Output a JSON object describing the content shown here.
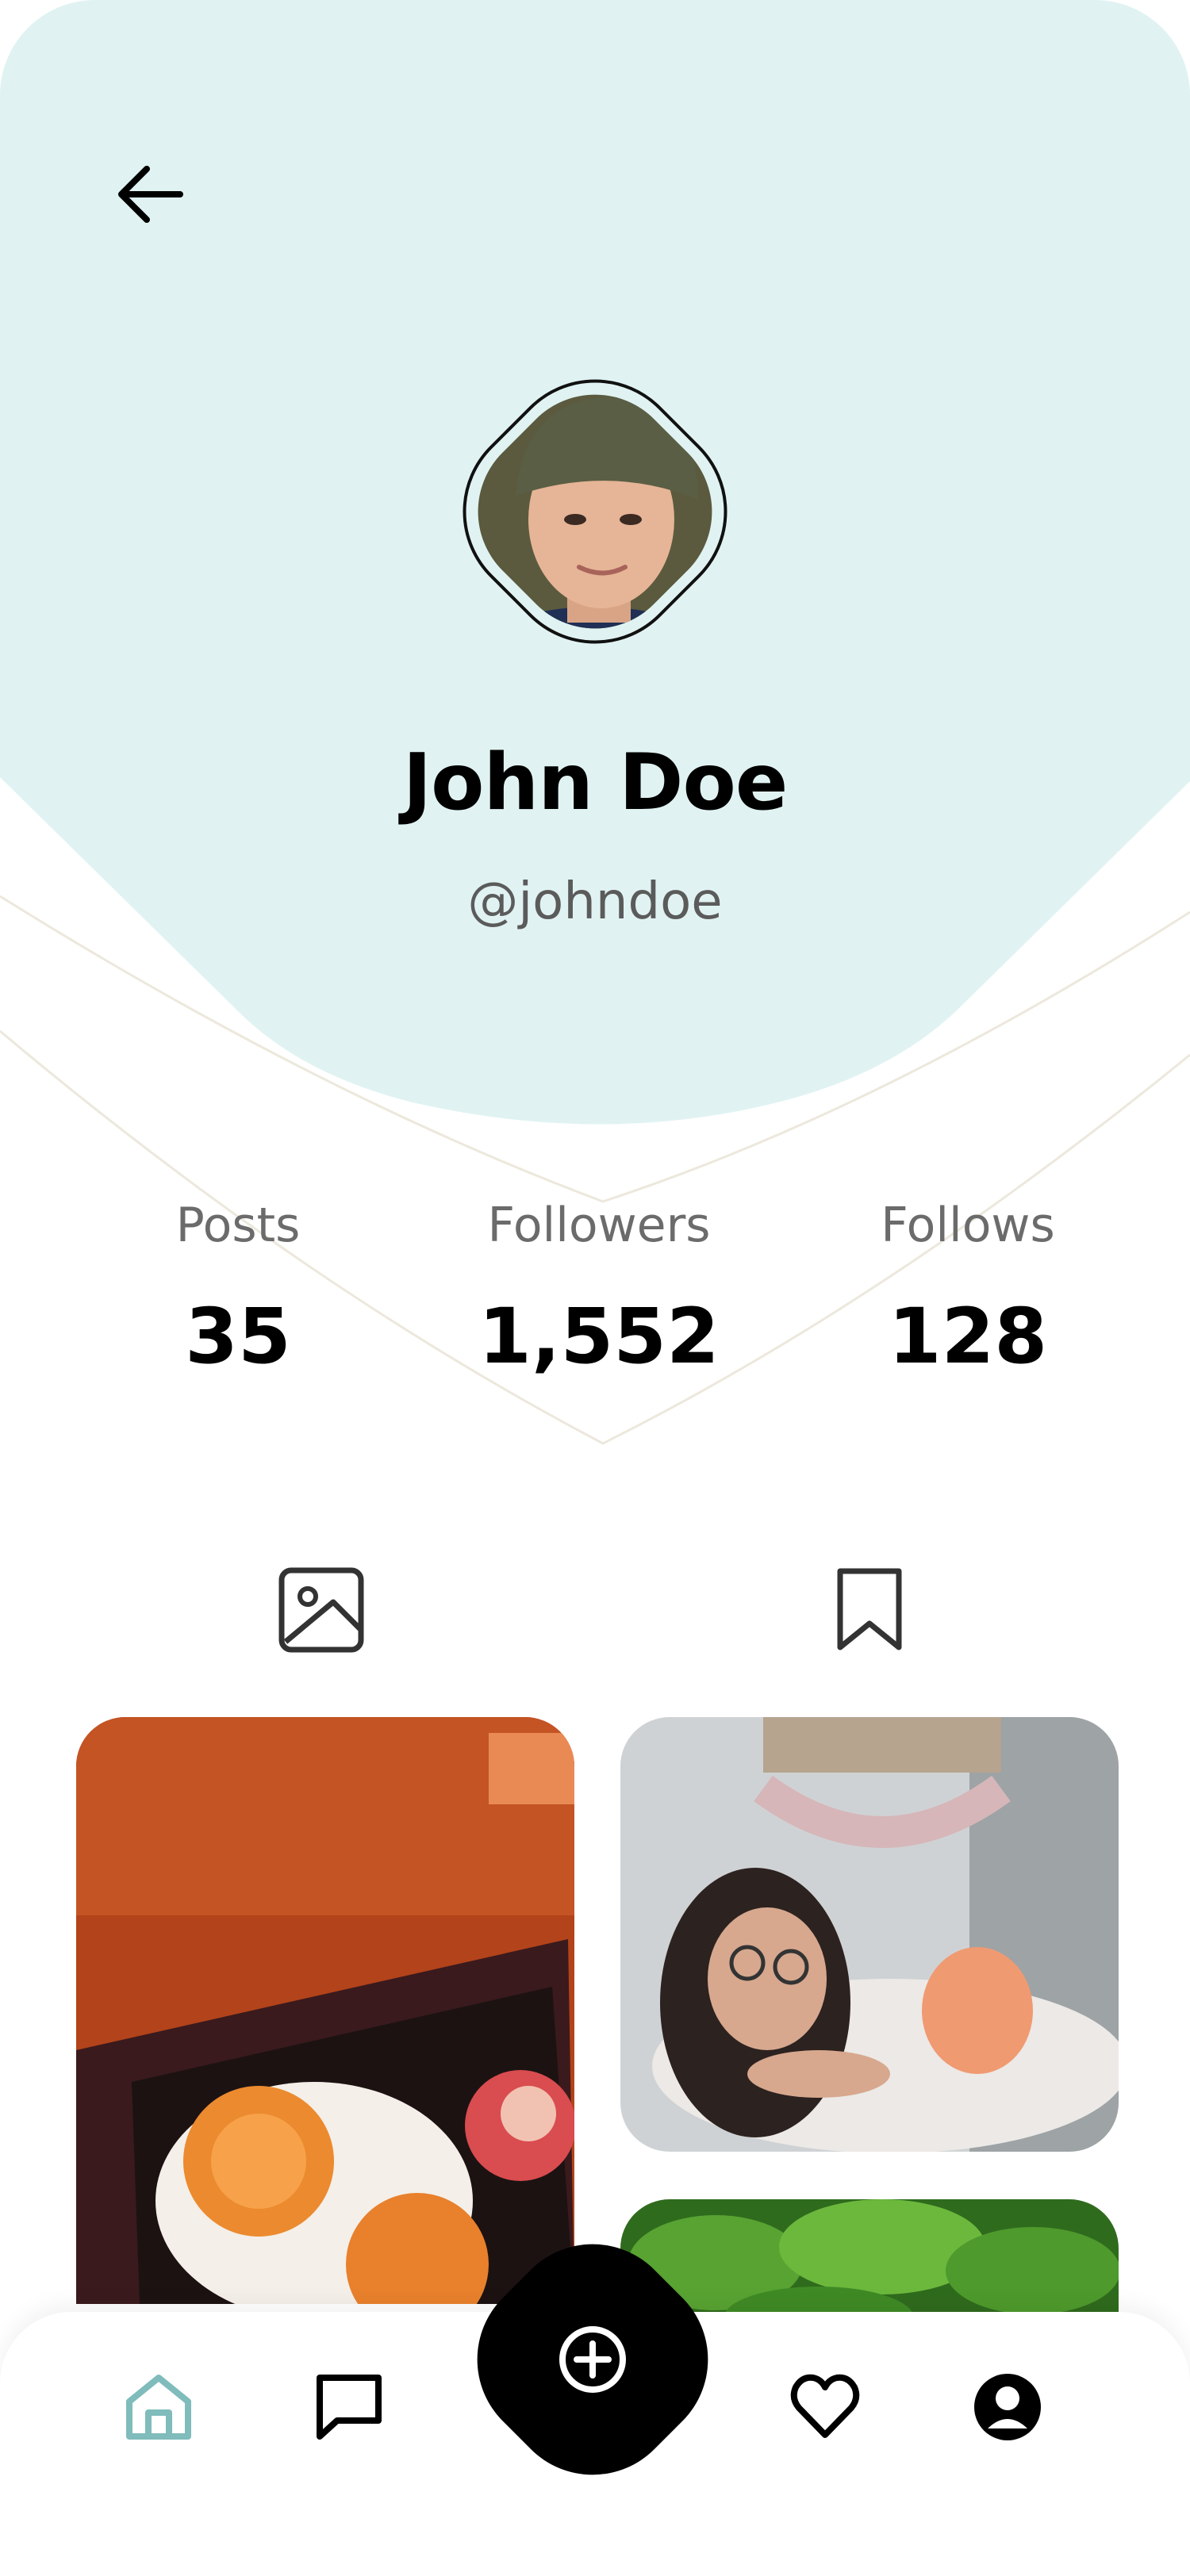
{
  "colors": {
    "header_bg": "#e0f3f2",
    "accent": "#7fbcbb",
    "text_primary": "#000000",
    "text_secondary": "#6b6b6b"
  },
  "header": {
    "back_icon": "arrow-left-icon"
  },
  "profile": {
    "name": "John Doe",
    "handle": "@johndoe",
    "avatar": "profile-photo"
  },
  "stats": [
    {
      "label": "Posts",
      "value": "35"
    },
    {
      "label": "Followers",
      "value": "1,552"
    },
    {
      "label": "Follows",
      "value": "128"
    }
  ],
  "content_tabs": [
    {
      "icon": "image-icon",
      "active": true
    },
    {
      "icon": "bookmark-icon",
      "active": false
    }
  ],
  "photos": [
    {
      "subject": "orange fruit platter"
    },
    {
      "subject": "girl with glasses"
    },
    {
      "subject": "green leaves"
    }
  ],
  "bottom_nav": [
    {
      "icon": "home-icon",
      "active": true
    },
    {
      "icon": "chat-icon",
      "active": false
    },
    {
      "icon": "add-circle-icon",
      "active": false
    },
    {
      "icon": "heart-icon",
      "active": false
    },
    {
      "icon": "account-icon",
      "active": false
    }
  ]
}
